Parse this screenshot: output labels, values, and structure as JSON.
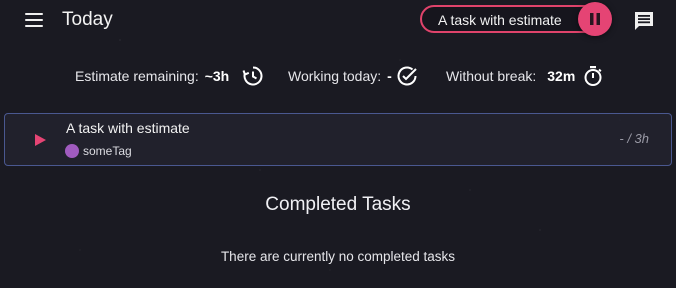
{
  "header": {
    "title": "Today",
    "current_task": "A task with estimate",
    "icons": {
      "menu": "menu-icon",
      "pause": "pause-icon",
      "notes": "notes-icon"
    },
    "accent_color": "#e54474"
  },
  "metrics": {
    "estimate_label": "Estimate remaining:",
    "estimate_value": "~3h",
    "working_label": "Working today:",
    "working_value": "-",
    "break_label": "Without break:",
    "break_value": "32m"
  },
  "task": {
    "title": "A task with estimate",
    "tag": "someTag",
    "tag_color": "#a05bbf",
    "time": "- / 3h"
  },
  "completed": {
    "title": "Completed Tasks",
    "empty_message": "There are currently no completed tasks"
  }
}
